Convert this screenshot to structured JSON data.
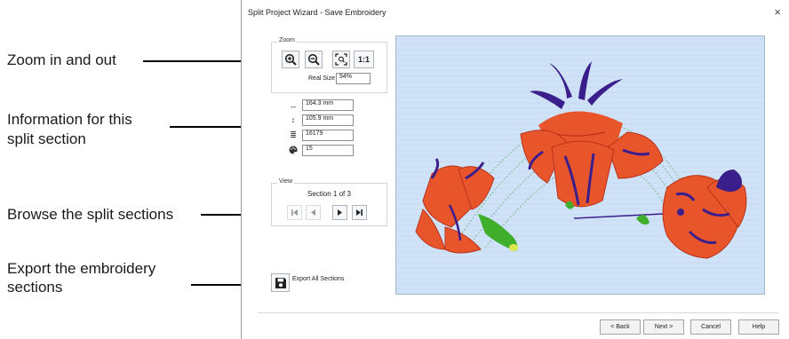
{
  "callouts": {
    "zoom": "Zoom in and out",
    "info_line1": "Information for this",
    "info_line2": "split section",
    "browse": "Browse the split sections",
    "export_line1": "Export the embroidery",
    "export_line2": "sections"
  },
  "dialog": {
    "title": "Split Project Wizard - Save Embroidery",
    "close_glyph": "×"
  },
  "zoom": {
    "group_label": "Zoom",
    "real_size_label": "Real Size",
    "real_size_value": "94%",
    "one_to_one_label": "1:1"
  },
  "info": {
    "width": "164.3 mm",
    "height": "105.9 mm",
    "stitches": "16179",
    "colors": "15",
    "icons": [
      "width-arrows-icon",
      "height-arrows-icon",
      "stitch-count-icon",
      "palette-icon"
    ]
  },
  "view": {
    "group_label": "View",
    "section_text": "Section 1 of 3"
  },
  "export": {
    "label": "Export All Sections"
  },
  "buttons": {
    "back": "< Back",
    "next": "Next >",
    "cancel": "Cancel",
    "help": "Help"
  },
  "colors": {
    "preview_background": "#cfe2f7",
    "petal": "#e8552b",
    "petal_dark": "#b8321a",
    "purple": "#3a1e8c",
    "green": "#3fae2a",
    "stitch_guides": "#7fb98a"
  }
}
